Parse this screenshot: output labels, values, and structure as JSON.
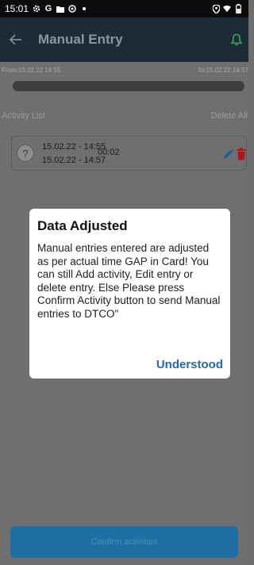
{
  "status_bar": {
    "time": "15:01",
    "left_icons": [
      "gear-icon",
      "google-icon",
      "folder-icon",
      "settings-icon",
      "dot-icon"
    ],
    "right_icons": [
      "location-icon",
      "wifi-icon",
      "battery-icon"
    ]
  },
  "app_bar": {
    "title": "Manual Entry",
    "back_icon": "arrow-left-icon",
    "action_icon": "bell-icon",
    "action_color": "#3aa84a"
  },
  "time_range": {
    "from": "From:15.02.22 14:55",
    "to": "To:15.02.22 14:57"
  },
  "activity_list": {
    "title": "Activity List",
    "delete_all": "Delete All",
    "items": [
      {
        "badge": "?",
        "start": "15.02.22 - 14:55",
        "end": "15.02.22 - 14:57",
        "duration": "00:02",
        "edit_color": "#1b5e96",
        "delete_color": "#b3141c"
      }
    ]
  },
  "dialog": {
    "title": "Data Adjusted",
    "body": "Manual entries entered are adjusted as per actual time GAP in Card! You can still Add activity, Edit entry or delete entry. Else Please press Confirm Activity button to send Manual entries to DTCO\"",
    "button": "Understood"
  },
  "footer": {
    "confirm_label": "Confirm activities"
  },
  "colors": {
    "app_bar": "#1d2a38",
    "accent": "#1f6fa5",
    "dialog_button": "#2468a5"
  }
}
